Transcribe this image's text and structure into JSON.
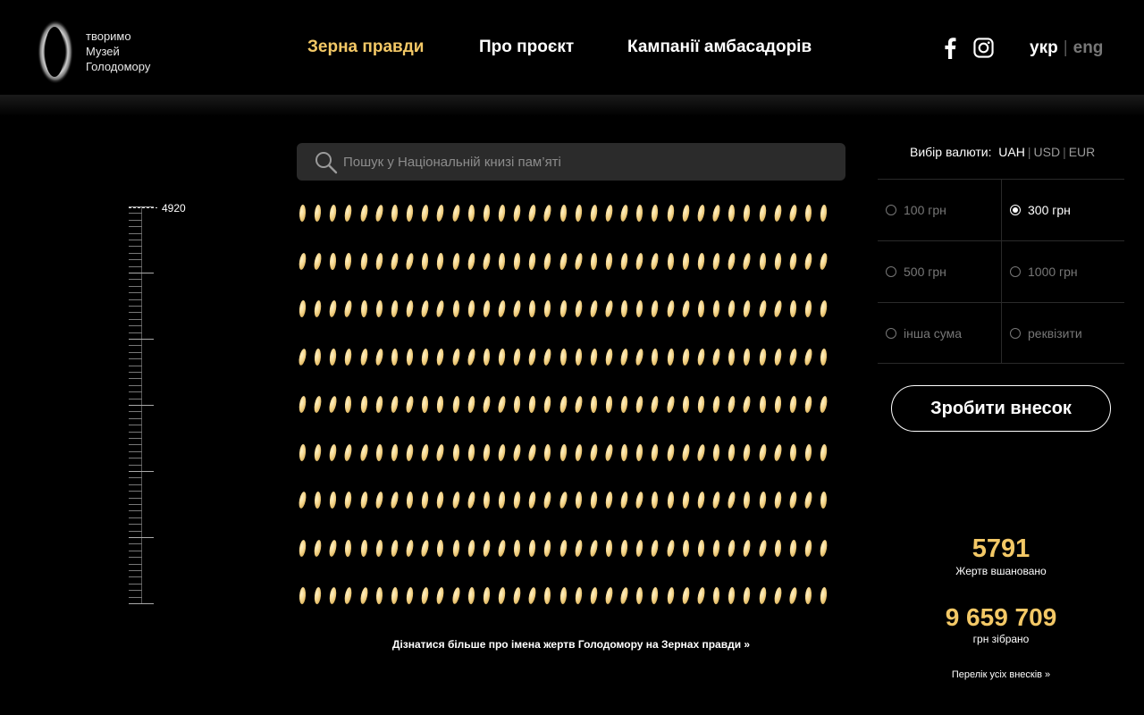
{
  "logo": {
    "line1": "творимо",
    "line2": "Музей",
    "line3": "Голодомору"
  },
  "nav": {
    "items": [
      {
        "label": "Зерна правди",
        "active": true
      },
      {
        "label": "Про проєкт",
        "active": false
      },
      {
        "label": "Кампанії амбасадорів",
        "active": false
      }
    ]
  },
  "social": {
    "facebook_icon": "facebook-icon",
    "instagram_icon": "instagram-icon"
  },
  "lang": {
    "current": "укр",
    "separator": "|",
    "other": "eng"
  },
  "scale": {
    "label": "4920"
  },
  "search": {
    "placeholder": "Пошук у Національній книзі пам’яті"
  },
  "grains": {
    "rows": 9,
    "per_row": 35
  },
  "more_link": "Дізнатися більше про імена жертв Голодомору на Зернах правди »",
  "currency": {
    "label": "Вибір валюти:",
    "options": [
      "UAH",
      "USD",
      "EUR"
    ],
    "selected": "UAH",
    "separator": "|"
  },
  "amounts": [
    {
      "label": "100 грн",
      "selected": false
    },
    {
      "label": "300 грн",
      "selected": true
    },
    {
      "label": "500 грн",
      "selected": false
    },
    {
      "label": "1000 грн",
      "selected": false
    },
    {
      "label": "інша сума",
      "selected": false
    },
    {
      "label": "реквізити",
      "selected": false
    }
  ],
  "donate_button": "Зробити внесок",
  "stats": {
    "victims_count": "5791",
    "victims_caption": "Жертв вшановано",
    "collected_amount": "9 659 709",
    "collected_caption": "грн зібрано"
  },
  "all_contributions_link": "Перелік усіх внесків »",
  "colors": {
    "accent": "#f3c866",
    "background": "#000000"
  }
}
